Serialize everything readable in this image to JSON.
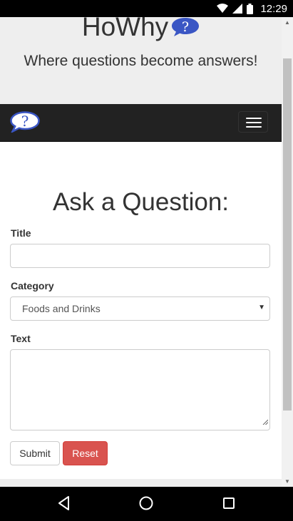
{
  "status_bar": {
    "time": "12:29",
    "icons": [
      "wifi-icon",
      "signal-icon",
      "battery-icon"
    ]
  },
  "header": {
    "brand_title": "HoWhy",
    "logo_icon": "question-bubble-icon",
    "tagline": "Where questions become answers!"
  },
  "navbar": {
    "logo_icon": "question-bubble-icon",
    "toggle_icon": "hamburger-menu-icon"
  },
  "form": {
    "heading": "Ask a Question:",
    "title_label": "Title",
    "title_value": "",
    "category_label": "Category",
    "category_selected": "Foods and Drinks",
    "text_label": "Text",
    "text_value": "",
    "submit_label": "Submit",
    "reset_label": "Reset"
  },
  "colors": {
    "navbar_bg": "#222222",
    "jumbotron_bg": "#eeeeee",
    "reset_button": "#d9534f",
    "bubble_blue": "#3a56c4"
  },
  "system_nav": {
    "back_icon": "back-triangle-icon",
    "home_icon": "home-circle-icon",
    "recents_icon": "recents-square-icon"
  }
}
